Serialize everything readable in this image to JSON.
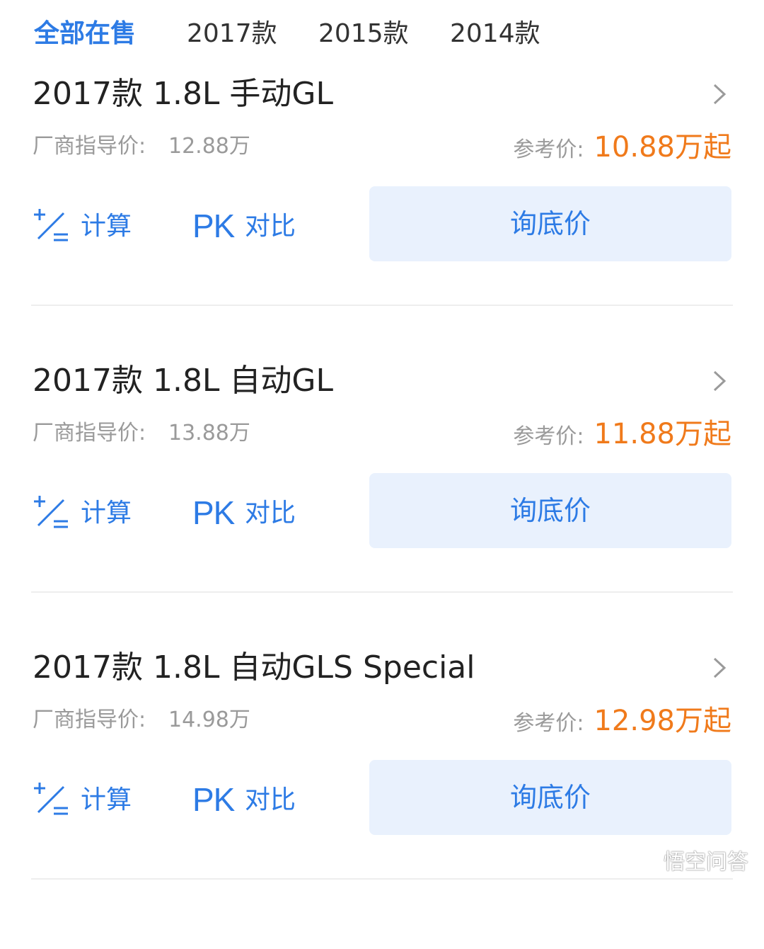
{
  "tabs": [
    {
      "label": "全部在售",
      "active": true
    },
    {
      "label": "2017款",
      "active": false
    },
    {
      "label": "2015款",
      "active": false
    },
    {
      "label": "2014款",
      "active": false
    }
  ],
  "items": [
    {
      "title": "2017款 1.8L 手动GL",
      "guide_label": "厂商指导价:",
      "guide_price": "12.88万",
      "ref_label": "参考价:",
      "ref_price": "10.88万起",
      "calc_label": "计算",
      "pk_icon": "PK",
      "compare_label": "对比",
      "inquire_label": "询底价"
    },
    {
      "title": "2017款 1.8L 自动GL",
      "guide_label": "厂商指导价:",
      "guide_price": "13.88万",
      "ref_label": "参考价:",
      "ref_price": "11.88万起",
      "calc_label": "计算",
      "pk_icon": "PK",
      "compare_label": "对比",
      "inquire_label": "询底价"
    },
    {
      "title": "2017款 1.8L 自动GLS Special",
      "guide_label": "厂商指导价:",
      "guide_price": "14.98万",
      "ref_label": "参考价:",
      "ref_price": "12.98万起",
      "calc_label": "计算",
      "pk_icon": "PK",
      "compare_label": "对比",
      "inquire_label": "询底价"
    }
  ],
  "watermark": {
    "text": "悟空问答",
    "icon": "wukong-logo-icon"
  },
  "colors": {
    "accent": "#2d7be5",
    "price": "#f07a1b",
    "button_bg": "#e9f1fd"
  },
  "icons": {
    "calculator": "plus-slash-equals-icon",
    "chevron": "chevron-right-icon"
  }
}
